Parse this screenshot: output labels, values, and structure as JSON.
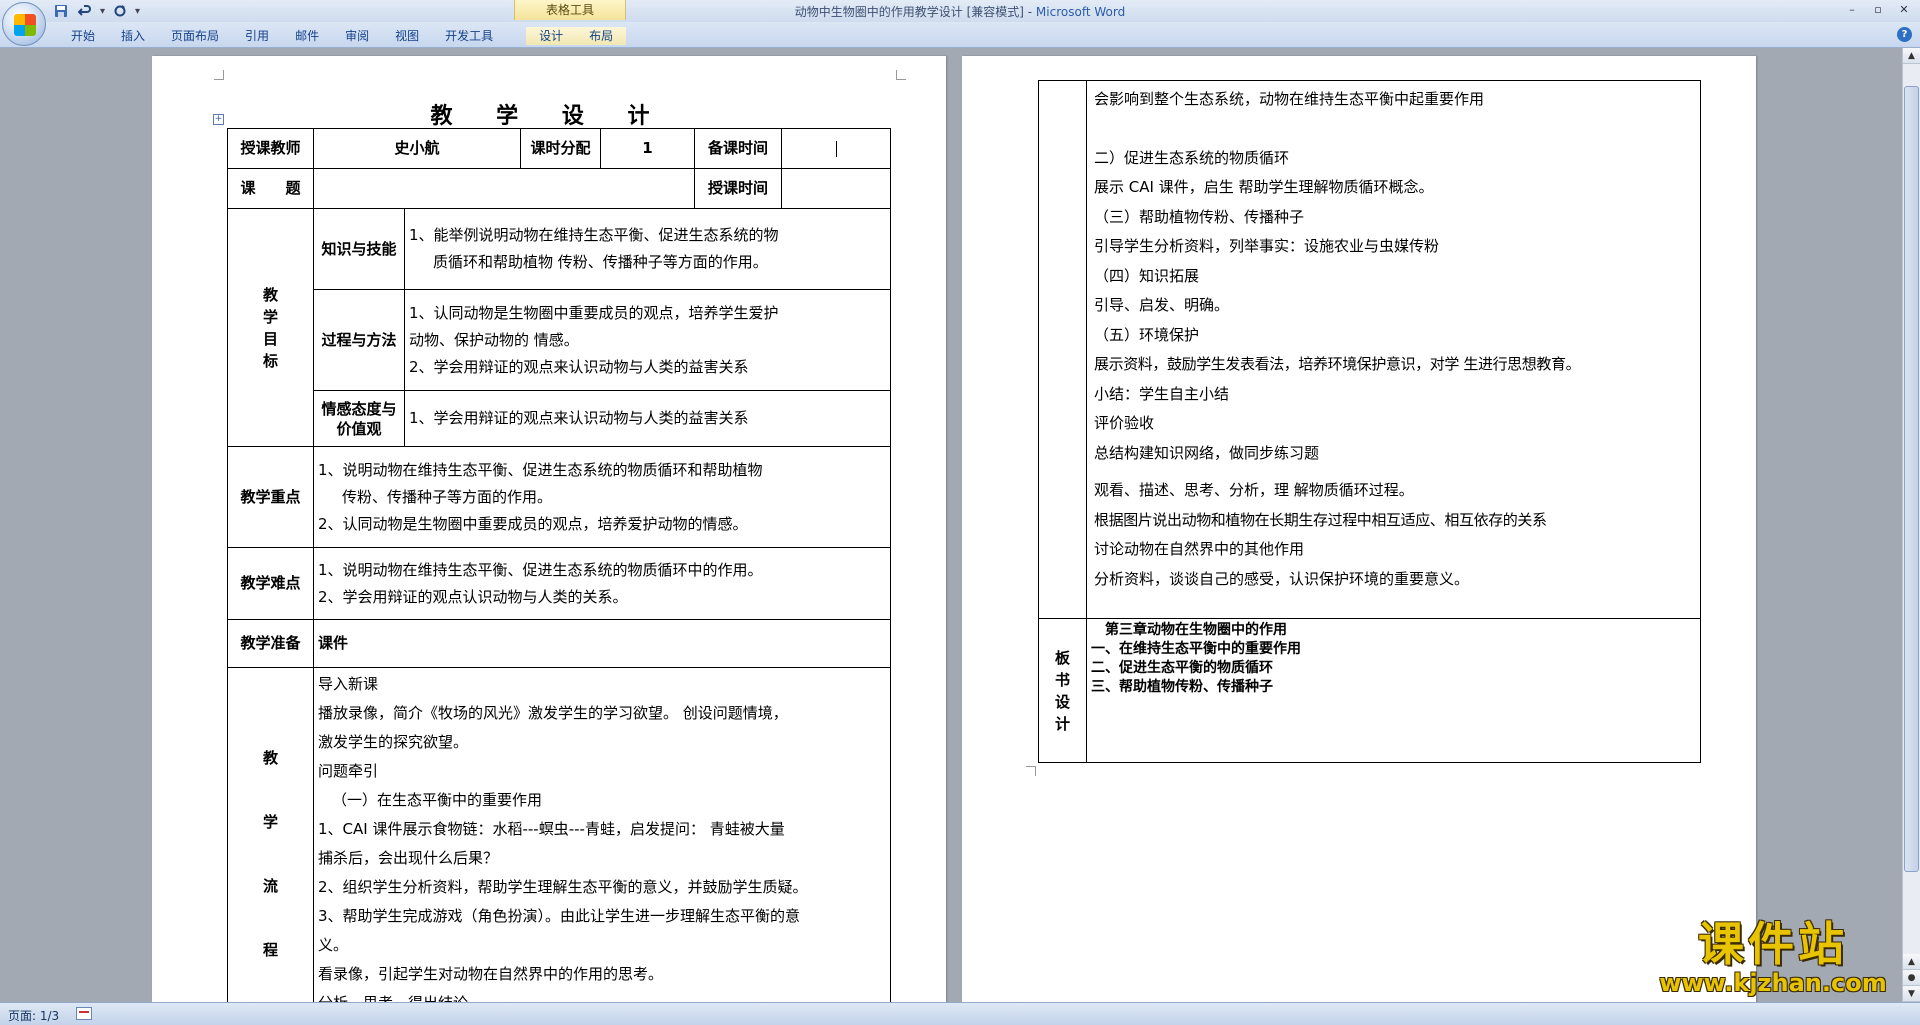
{
  "window": {
    "title": "动物中生物圈中的作用教学设计 [兼容模式] - ",
    "app_name": "Microsoft Word",
    "context_tab_group": "表格工具"
  },
  "ribbon": {
    "tabs": [
      "开始",
      "插入",
      "页面布局",
      "引用",
      "邮件",
      "审阅",
      "视图",
      "开发工具",
      "设计",
      "布局"
    ]
  },
  "icons": {
    "office_button": "office-button-icon",
    "save": "save-icon",
    "undo": "undo-icon",
    "redo": "redo-icon",
    "help": "help-icon"
  },
  "qat": {
    "undo_dropdown": "▾",
    "customize": "▾"
  },
  "help_label": "?",
  "win_controls": {
    "minimize": "–",
    "maximize": "▫",
    "close": "✕"
  },
  "page1": {
    "title": "教 学 设 计",
    "move_handle": "+",
    "row1": {
      "teacher_label": "授课教师",
      "teacher_value": "史小航",
      "hours_label": "课时分配",
      "hours_value": "1",
      "prep_time_label": "备课时间",
      "prep_time_value": ""
    },
    "row2": {
      "topic_label": "课　　题",
      "topic_value": "",
      "class_time_label": "授课时间",
      "class_time_value": ""
    },
    "goals": {
      "label_chars": [
        "教",
        "学",
        "目",
        "标"
      ],
      "knowledge_label": "知识与技能",
      "knowledge_text": [
        "1、能举例说明动物在维持生态平衡、促进生态系统的物",
        "质循环和帮助植物 传粉、传播种子等方面的作用。"
      ],
      "process_label": "过程与方法",
      "process_text": [
        "1、认同动物是生物圈中重要成员的观点，培养学生爱护",
        "动物、保护动物的 情感。",
        "2、学会用辩证的观点来认识动物与人类的益害关系"
      ],
      "emotion_label": "情感态度与价值观",
      "emotion_text": "1、学会用辩证的观点来认识动物与人类的益害关系"
    },
    "key_points": {
      "label": "教学重点",
      "lines": [
        "1、说明动物在维持生态平衡、促进生态系统的物质循环和帮助植物",
        "传粉、传播种子等方面的作用。",
        "2、认同动物是生物圈中重要成员的观点，培养爱护动物的情感。"
      ]
    },
    "difficulties": {
      "label": "教学难点",
      "lines": [
        "1、说明动物在维持生态平衡、促进生态系统的物质循环中的作用。",
        "2、学会用辩证的观点认识动物与人类的关系。"
      ]
    },
    "preparation": {
      "label": "教学准备",
      "value": "课件"
    },
    "process": {
      "label_chars": [
        "教",
        "学",
        "流",
        "程"
      ],
      "lines": [
        "导入新课",
        "播放录像，简介《牧场的风光》激发学生的学习欲望。 创设问题情境，",
        "激发学生的探究欲望。",
        "问题牵引",
        "（一）在生态平衡中的重要作用",
        "1、CAI 课件展示食物链：水稻---螟虫---青蛙，启发提问： 青蛙被大量",
        "捕杀后，会出现什么后果？",
        "2、组织学生分析资料，帮助学生理解生态平衡的意义，并鼓励学生质疑。",
        "3、帮助学生完成游戏（角色扮演）。由此让学生进一步理解生态平衡的意",
        "义。",
        "看录像，引起学生对动物在自然界中的作用的思考。",
        "分析、思考，得出结论"
      ]
    }
  },
  "page2": {
    "flow_lines": [
      "会影响到整个生态系统，动物在维持生态平衡中起重要作用",
      "",
      "二）促进生态系统的物质循环",
      "展示 CAI 课件，启生 帮助学生理解物质循环概念。",
      "（三）帮助植物传粉、传播种子",
      "引导学生分析资料，列举事实：设施农业与虫媒传粉",
      "（四）知识拓展",
      "引导、启发、明确。",
      "（五）环境保护",
      "展示资料，鼓励学生发表看法，培养环境保护意识，对学 生进行思想教育。",
      "小结：学生自主小结",
      "评价验收",
      "总结构建知识网络，做同步练习题",
      "观看、描述、思考、分析，理 解物质循环过程。",
      "根据图片说出动物和植物在长期生存过程中相互适应、相互依存的关系",
      "讨论动物在自然界中的其他作用",
      "分析资料，谈谈自己的感受，认识保护环境的重要意义。",
      ""
    ],
    "board": {
      "label_chars": [
        "板",
        "书",
        "设",
        "计"
      ],
      "lines": [
        "第三章动物在生物圈中的作用",
        "一、在维持生态平衡中的重要作用",
        "二、促进生态平衡的物质循环",
        "三、帮助植物传粉、传播种子"
      ]
    }
  },
  "status": {
    "page": "页面: 1/3"
  },
  "watermark": {
    "title": "课件站",
    "url": "www.kjzhan.com"
  }
}
